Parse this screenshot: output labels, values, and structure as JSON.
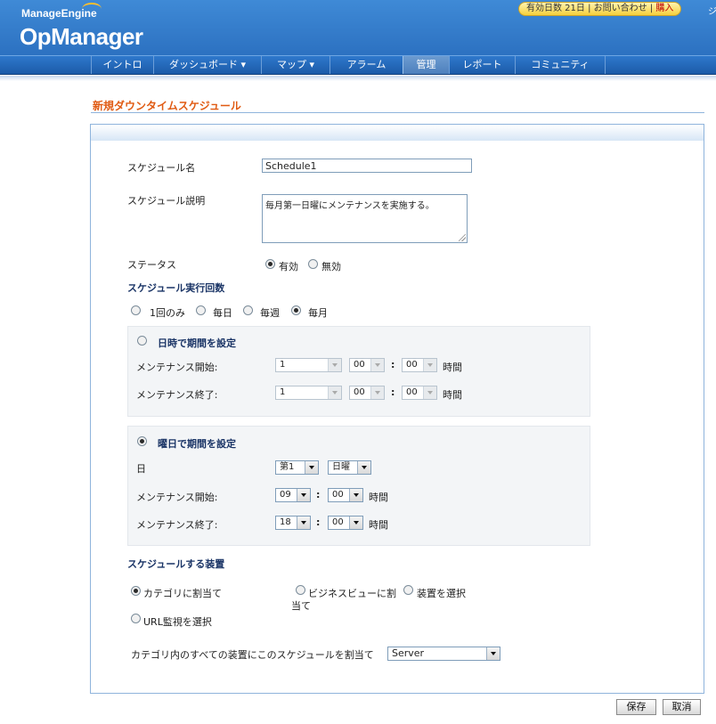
{
  "header": {
    "brand_small": "ManageEngine",
    "brand_main": "OpManager",
    "trial_days": "有効日数 21日",
    "contact": "お問い合わせ",
    "purchase": "購入",
    "edge_char": "ジ"
  },
  "nav": [
    "イントロ",
    "ダッシュボード ▾",
    "マップ ▾",
    "アラーム",
    "管理",
    "レポート",
    "コミュニティ"
  ],
  "page": {
    "title": "新規ダウンタイムスケジュール"
  },
  "form": {
    "name_label": "スケジュール名",
    "name_value": "Schedule1",
    "desc_label": "スケジュール説明",
    "desc_value": "毎月第一日曜にメンテナンスを実施する。",
    "status_label": "ステータス",
    "status_enabled": "有効",
    "status_disabled": "無効",
    "status_selected": "有効",
    "freq_heading": "スケジュール実行回数",
    "freq_once": "1回のみ",
    "freq_daily": "毎日",
    "freq_weekly": "毎週",
    "freq_monthly": "毎月",
    "freq_selected": "毎月",
    "date_section": {
      "title": "日時で期間を設定",
      "start_label": "メンテナンス開始:",
      "end_label": "メンテナンス終了:",
      "start_day": "1",
      "start_hour": "00",
      "start_min": "00",
      "end_day": "1",
      "end_hour": "00",
      "end_min": "00",
      "hour_unit": "時間"
    },
    "weekday_section": {
      "title": "曜日で期間を設定",
      "day_label": "日",
      "week_value": "第1",
      "weekday_value": "日曜",
      "start_label": "メンテナンス開始:",
      "end_label": "メンテナンス終了:",
      "start_hour": "09",
      "start_min": "00",
      "end_hour": "18",
      "end_min": "00",
      "hour_unit": "時間"
    },
    "devices_heading": "スケジュールする装置",
    "dev_category": "カテゴリに割当て",
    "dev_business_line1": "ビジネスビューに割",
    "dev_business_line2": "当て",
    "dev_select": "装置を選択",
    "dev_url": "URL監視を選択",
    "assign_label": "カテゴリ内のすべての装置にこのスケジュールを割当て",
    "category_value": "Server"
  },
  "buttons": {
    "save": "保存",
    "cancel": "取消"
  },
  "colors": {
    "header_blue": "#2c71c1",
    "title_orange": "#e05a12",
    "pill_yellow": "#f5cf3b"
  }
}
